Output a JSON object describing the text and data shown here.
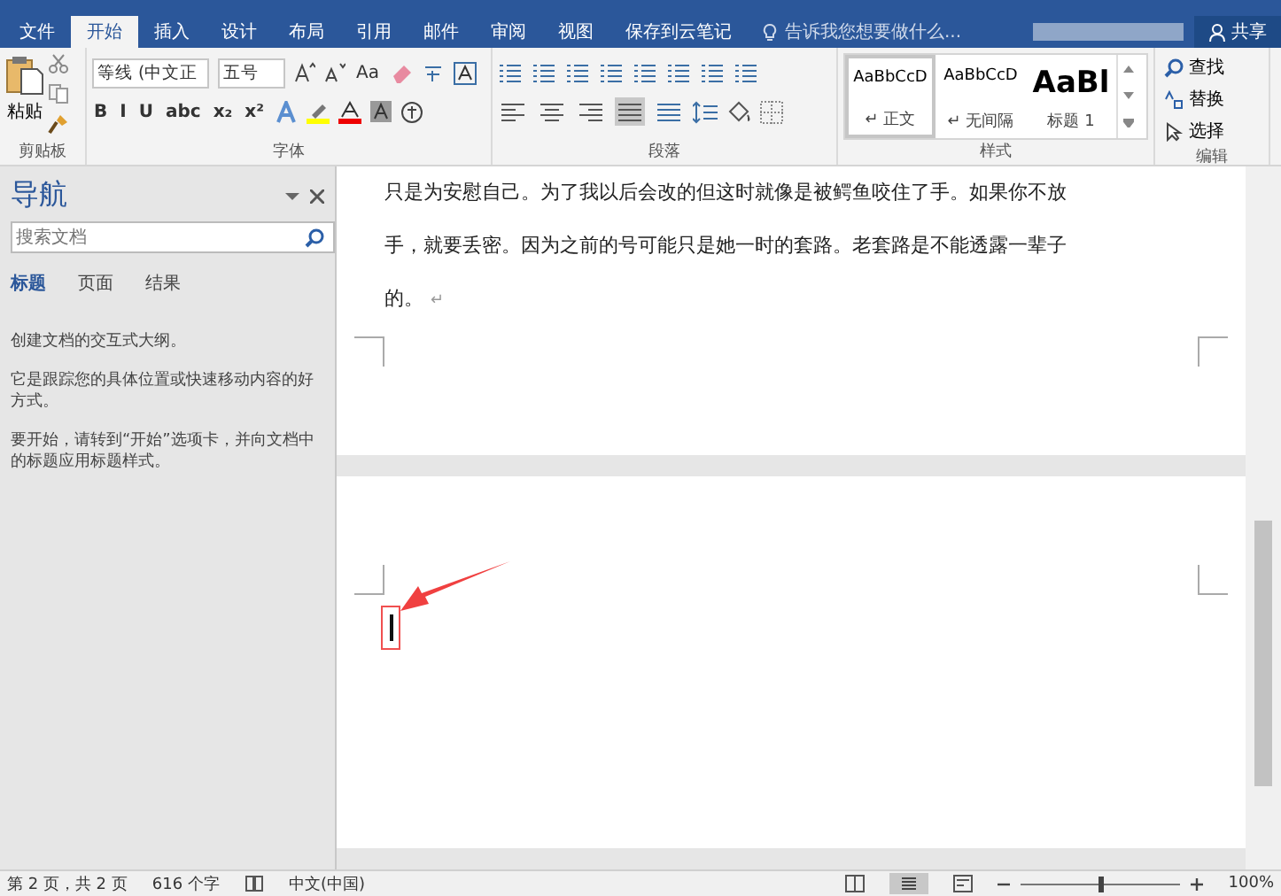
{
  "ribbon_tabs": [
    {
      "label": "文件",
      "selected": false
    },
    {
      "label": "开始",
      "selected": true
    },
    {
      "label": "插入",
      "selected": false
    },
    {
      "label": "设计",
      "selected": false
    },
    {
      "label": "布局",
      "selected": false
    },
    {
      "label": "引用",
      "selected": false
    },
    {
      "label": "邮件",
      "selected": false
    },
    {
      "label": "审阅",
      "selected": false
    },
    {
      "label": "视图",
      "selected": false
    },
    {
      "label": "保存到云笔记",
      "selected": false
    }
  ],
  "tell_me": "告诉我您想要做什么...",
  "share": "共享",
  "clipboard": {
    "paste": "粘贴",
    "label": "剪贴板"
  },
  "font": {
    "name": "等线 (中文正",
    "size": "五号",
    "case_button": "Aa",
    "format_buttons": [
      "B",
      "I",
      "U",
      "abc",
      "x₂",
      "x²"
    ],
    "label": "字体"
  },
  "paragraph": {
    "align_buttons": [
      {
        "kind": "left",
        "selected": false
      },
      {
        "kind": "center",
        "selected": false
      },
      {
        "kind": "right",
        "selected": false
      },
      {
        "kind": "justify",
        "selected": true
      },
      {
        "kind": "distributed",
        "selected": false
      }
    ],
    "label": "段落"
  },
  "styles": {
    "items": [
      {
        "preview": "AaBbCcD",
        "name": "↵ 正文",
        "kind": "normal",
        "selected": true
      },
      {
        "preview": "AaBbCcD",
        "name": "↵ 无间隔",
        "kind": "normal",
        "selected": false
      },
      {
        "preview": "AaBl",
        "name": "标题 1",
        "kind": "heading",
        "selected": false
      }
    ],
    "label": "样式"
  },
  "editing": {
    "items": [
      "查找",
      "替换",
      "选择"
    ],
    "label": "编辑"
  },
  "navigation": {
    "title": "导航",
    "search_placeholder": "搜索文档",
    "tabs": [
      {
        "label": "标题",
        "selected": true
      },
      {
        "label": "页面",
        "selected": false
      },
      {
        "label": "结果",
        "selected": false
      }
    ],
    "paragraphs": [
      "创建文档的交互式大纲。",
      "它是跟踪您的具体位置或快速移动内容的好方式。",
      "要开始，请转到“开始”选项卡，并向文档中的标题应用标题样式。"
    ]
  },
  "document": {
    "text": "只是为安慰自己。为了我以后会改的但这时就像是被鳄鱼咬住了手。如果你不放手，就要丢密。因为之前的号可能只是她一时的套路。老套路是不能透露一辈子的。",
    "paragraph_mark": "↵"
  },
  "status_bar": {
    "page": "第 2 页，共 2 页",
    "words": "616 个字",
    "language": "中文(中国)",
    "zoom": "100%",
    "zoom_slider": {
      "level": 0.5
    }
  }
}
